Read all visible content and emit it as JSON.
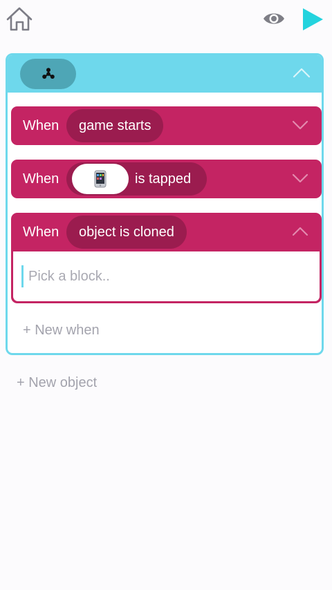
{
  "toolbar": {
    "home_icon": "home-icon",
    "preview_icon": "eye-icon",
    "play_icon": "play-icon",
    "play_color": "#24d3de"
  },
  "object": {
    "icon": "fidget-spinner-icon",
    "header_color": "#6ed8ec",
    "collapse_icon": "chevron-up-icon",
    "rules": [
      {
        "when_label": "When",
        "trigger": "game starts",
        "state": "collapsed"
      },
      {
        "when_label": "When",
        "trigger_object_icon": "phone-icon",
        "trigger": "is tapped",
        "state": "collapsed"
      },
      {
        "when_label": "When",
        "trigger": "object is cloned",
        "state": "expanded",
        "placeholder": "Pick a block.."
      }
    ],
    "new_when_label": "+ New when"
  },
  "new_object_label": "+ New object",
  "colors": {
    "rule_block": "#c42463",
    "rule_pill": "#9b1c4f"
  }
}
